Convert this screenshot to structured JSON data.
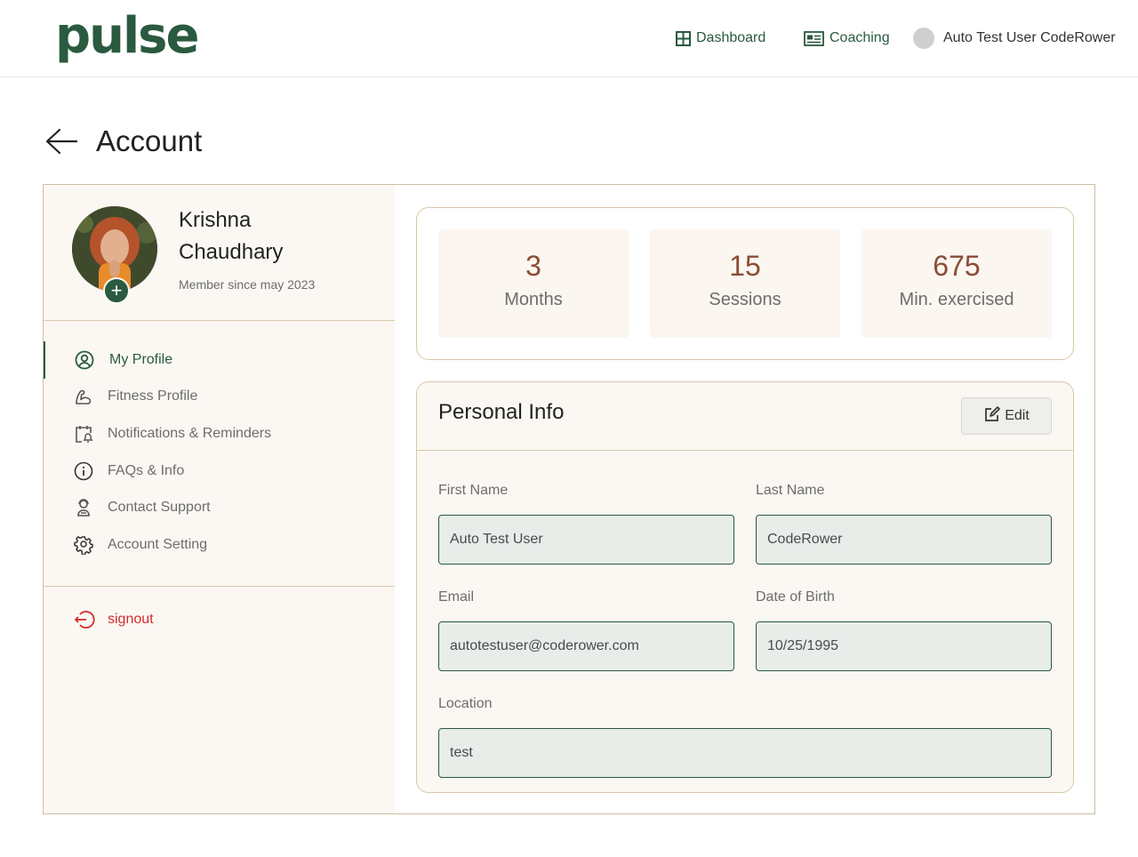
{
  "brand": {
    "logo_text": "pulse",
    "color": "#2a5a3f"
  },
  "topnav": {
    "dashboard_label": "Dashboard",
    "dashboard_icon": "grid-icon",
    "coaching_label": "Coaching",
    "coaching_icon": "id-card-icon",
    "user_name": "Auto Test User CodeRower"
  },
  "page": {
    "title": "Account",
    "back_icon": "arrow-left-icon"
  },
  "profile": {
    "name": "Krishna Chaudhary",
    "member_since": "Member since may 2023",
    "add_photo_glyph": "+"
  },
  "sidebar": {
    "items": [
      {
        "label": "My Profile",
        "icon": "user-circle-icon",
        "active": true
      },
      {
        "label": "Fitness Profile",
        "icon": "muscle-arm-icon",
        "active": false
      },
      {
        "label": "Notifications & Reminders",
        "icon": "calendar-bell-icon",
        "active": false
      },
      {
        "label": "FAQs & Info",
        "icon": "info-icon",
        "active": false
      },
      {
        "label": "Contact Support",
        "icon": "support-agent-icon",
        "active": false
      },
      {
        "label": "Account Setting",
        "icon": "gear-icon",
        "active": false
      }
    ],
    "signout_label": "signout",
    "signout_color": "#d42b2b"
  },
  "stats": [
    {
      "value": "3",
      "label": "Months"
    },
    {
      "value": "15",
      "label": "Sessions"
    },
    {
      "value": "675",
      "label": "Min. exercised"
    }
  ],
  "personal_info": {
    "title": "Personal Info",
    "edit_label": "Edit",
    "fields": {
      "first_name": {
        "label": "First Name",
        "value": "Auto Test User"
      },
      "last_name": {
        "label": "Last Name",
        "value": "CodeRower"
      },
      "email": {
        "label": "Email",
        "value": "autotestuser@coderower.com"
      },
      "dob": {
        "label": "Date of Birth",
        "value": "10/25/1995"
      },
      "location": {
        "label": "Location",
        "value": "test"
      }
    }
  }
}
